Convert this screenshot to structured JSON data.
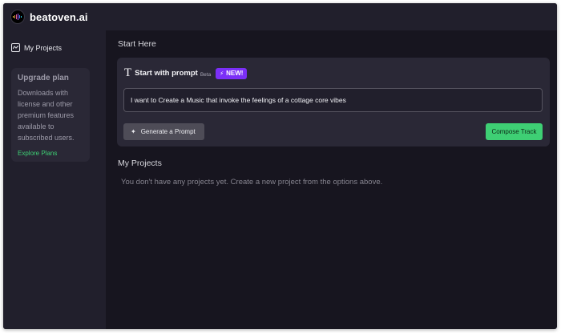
{
  "app": {
    "brand": "beatoven.ai"
  },
  "sidebar": {
    "nav": [
      {
        "label": "My Projects",
        "icon": "chart-line-icon"
      }
    ],
    "upgrade": {
      "title": "Upgrade plan",
      "text": "Downloads with license and other premium features available to subscribed users.",
      "link": "Explore Plans"
    }
  },
  "main": {
    "start_title": "Start Here",
    "prompt_card": {
      "icon": "T",
      "label": "Start with prompt",
      "beta": "Beta",
      "badge": "NEW!",
      "input_value": "I want to Create a Music that invoke the feelings of a cottage core vibes",
      "generate_label": "Generate a Prompt",
      "compose_label": "Compose Track"
    },
    "projects_title": "My Projects",
    "empty_text": "You don't have any projects yet. Create a new project from the options above."
  },
  "colors": {
    "background": "#17151f",
    "panel": "#211f2c",
    "card": "#2a2836",
    "accent_green": "#3ecf74",
    "badge_purple": "#7b2ff7"
  }
}
